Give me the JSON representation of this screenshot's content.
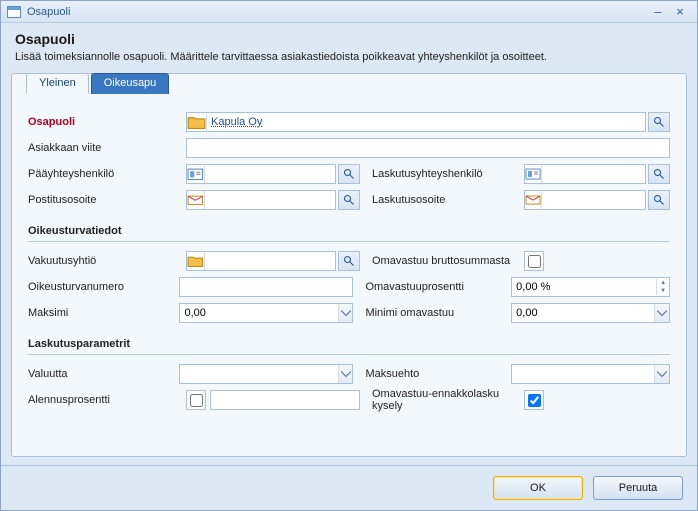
{
  "window": {
    "title": "Osapuoli"
  },
  "header": {
    "title": "Osapuoli",
    "subtitle": "Lisää toimeksiannolle osapuoli. Määrittele tarvittaessa asiakastiedoista poikkeavat yhteyshenkilöt ja osoitteet."
  },
  "tabs": {
    "general": "Yleinen",
    "legal_aid": "Oikeusapu"
  },
  "labels": {
    "party": "Osapuoli",
    "customer_ref": "Asiakkaan viite",
    "main_contact": "Pääyhteyshenkilö",
    "billing_contact": "Laskutusyhteyshenkilö",
    "mailing_address": "Postitusosoite",
    "billing_address": "Laskutusosoite",
    "legal_section": "Oikeusturvatiedot",
    "insurance_company": "Vakuutusyhtiö",
    "deductible_from_gross": "Omavastuu bruttosummasta",
    "legal_number": "Oikeusturvanumero",
    "deductible_percent": "Omavastuuprosentti",
    "maximum": "Maksimi",
    "min_deductible": "Minimi omavastuu",
    "billing_params": "Laskutusparametrit",
    "currency": "Valuutta",
    "payment_term": "Maksuehto",
    "discount_percent": "Alennusprosentti",
    "deductible_prompt": "Omavastuu-ennakkolasku kysely"
  },
  "values": {
    "party": "Kapula Oy",
    "customer_ref": "",
    "main_contact": "",
    "billing_contact": "",
    "mailing_address": "",
    "billing_address": "",
    "insurance_company": "",
    "legal_number": "",
    "deductible_percent": "0,00 %",
    "maximum": "0,00",
    "min_deductible": "0,00",
    "currency": "",
    "payment_term": "",
    "discount_value": ""
  },
  "checks": {
    "deductible_from_gross": false,
    "discount_percent": false,
    "deductible_prompt": true
  },
  "buttons": {
    "ok": "OK",
    "cancel": "Peruuta"
  }
}
